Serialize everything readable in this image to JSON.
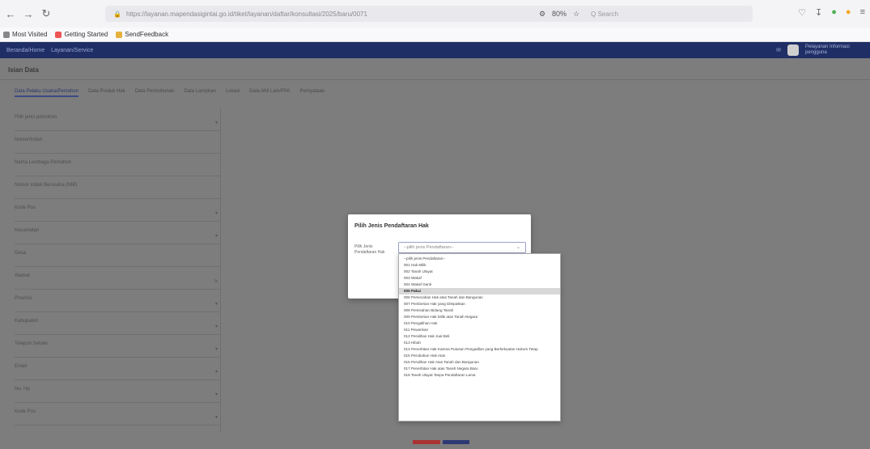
{
  "browser": {
    "url": "https://layanan.mapendasigintai.go.id/tiket/layanan/daftar/konsultasi/2025/baru/0071",
    "search_placeholder": "Q Search",
    "zoom": "80%",
    "bookmarks": [
      {
        "label": "Most Visited"
      },
      {
        "label": "Getting Started"
      },
      {
        "label": "SendFeedback"
      }
    ]
  },
  "app": {
    "header_links": [
      "Beranda/Home",
      "Layanan/Service"
    ],
    "user_line1": "Pelayanan Informasi",
    "user_line2": "pengguna"
  },
  "page": {
    "title": "Isian Data",
    "tabs": [
      {
        "label": "Data Pelaku Usaha/Pemohon"
      },
      {
        "label": "Data Produk Hak"
      },
      {
        "label": "Data Permohonan"
      },
      {
        "label": "Data Lampiran"
      },
      {
        "label": "Lokasi"
      },
      {
        "label": "Data Ahli Lain/PPA"
      },
      {
        "label": "Pernyataan"
      }
    ],
    "fields": [
      {
        "label": "Pilih jenis pemohon"
      },
      {
        "label": "Nomor/Induk"
      },
      {
        "label": "Nama Lembaga Pemohon"
      },
      {
        "label": "Nomor Induk Berusaha (NIB)"
      },
      {
        "label": "Kode Pos"
      },
      {
        "label": "Kecamatan"
      },
      {
        "label": "Desa"
      },
      {
        "label": "Alamat"
      },
      {
        "label": "Provinsi"
      },
      {
        "label": "Kabupaten"
      },
      {
        "label": "Telepon Seluler"
      },
      {
        "label": "Email"
      },
      {
        "label": "No. Hp"
      },
      {
        "label": "Kode Pos"
      }
    ]
  },
  "dialog": {
    "title": "Pilih Jenis Pendaftaran Hak",
    "label": "Pilih Jenis Pendaftaran Hak",
    "select_value": "--pilih jenis Pendaftaran--",
    "options": [
      "--pilih jenis Pendaftaran--",
      "001 Hak Milik",
      "002 Tanah Ulayat",
      "003 Wakaf",
      "004 Wakaf Ganti",
      "005 Pakai",
      "006 Pemecahan Hak atas Tanah dan Bangunan",
      "007 Pemberian Hak yang Dilepaskan",
      "008 Pemisahan Bidang Tanah",
      "009 Pemberian Hak Milik atas Tanah Negara",
      "010 Pengalihan Hak",
      "011 Pewarisan",
      "012 Peralihan Hak Jual Beli",
      "013 Hibah",
      "014 Penerbitan Hak Karena Putusan Pengadilan yang Berkekuatan Hukum Tetap",
      "015 Perubahan Hak Atas",
      "016 Peralihan Hak Atas Tanah dan Bangunan",
      "017 Penerbitan Hak atas Tanah Negara Baru",
      "018 Tanah Ulayat Tanpa Pendaftaran Lama"
    ],
    "selected_index": 5
  }
}
